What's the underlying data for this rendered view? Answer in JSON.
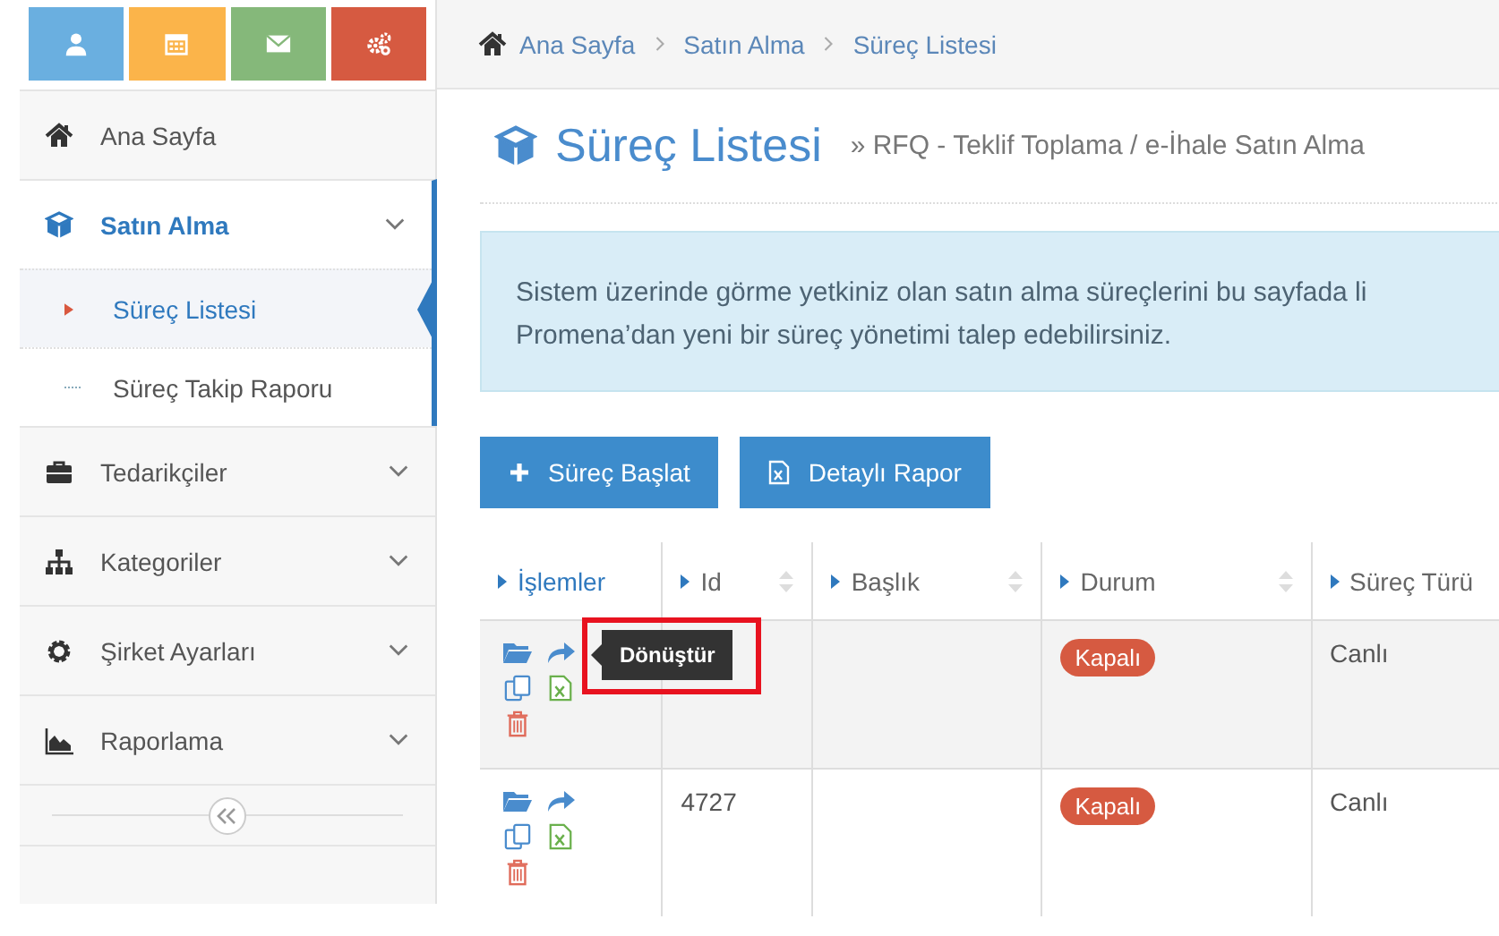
{
  "shortcuts": [
    {
      "color": "#6aafe0"
    },
    {
      "color": "#fbb44a"
    },
    {
      "color": "#85b87a"
    },
    {
      "color": "#d65a41"
    }
  ],
  "sidebar": {
    "items": [
      {
        "kind": "link",
        "label": "Ana Sayfa",
        "selected": false
      },
      {
        "kind": "menu",
        "label": "Satın Alma",
        "selected": true,
        "expanded": true,
        "children": [
          {
            "label": "Süreç Listesi",
            "selected": true
          },
          {
            "label": "Süreç Takip Raporu",
            "selected": false
          }
        ]
      },
      {
        "kind": "menu",
        "label": "Tedarikçiler",
        "selected": false
      },
      {
        "kind": "menu",
        "label": "Kategoriler",
        "selected": false
      },
      {
        "kind": "menu",
        "label": "Şirket Ayarları",
        "selected": false
      },
      {
        "kind": "menu",
        "label": "Raporlama",
        "selected": false
      }
    ]
  },
  "breadcrumb": [
    "Ana Sayfa",
    "Satın Alma",
    "Süreç Listesi"
  ],
  "page": {
    "title": "Süreç Listesi",
    "subtitle": "» RFQ - Teklif Toplama / e-İhale Satın Alma"
  },
  "info_lines": [
    "Sistem üzerinde görme yetkiniz olan satın alma süreçlerini bu sayfada li",
    "Promena’dan yeni bir süreç yönetimi talep edebilirsiniz."
  ],
  "buttons": [
    {
      "kind": "add",
      "label": "Süreç Başlat"
    },
    {
      "kind": "report",
      "label": "Detaylı Rapor"
    }
  ],
  "table": {
    "columns": [
      {
        "label": "İşlemler",
        "active": true,
        "sortable": false
      },
      {
        "label": "Id",
        "active": false,
        "sortable": true
      },
      {
        "label": "Başlık",
        "active": false,
        "sortable": true
      },
      {
        "label": "Durum",
        "active": false,
        "sortable": true
      },
      {
        "label": "Süreç Türü",
        "active": false,
        "sortable": false
      }
    ],
    "rows": [
      {
        "hover": true,
        "status": "Kapalı",
        "type": "Canlı"
      },
      {
        "hover": false,
        "id": "4727",
        "status": "Kapalı",
        "type": "Canlı"
      }
    ]
  },
  "tooltip": {
    "text": "Dönüştür",
    "highlighted": true
  }
}
